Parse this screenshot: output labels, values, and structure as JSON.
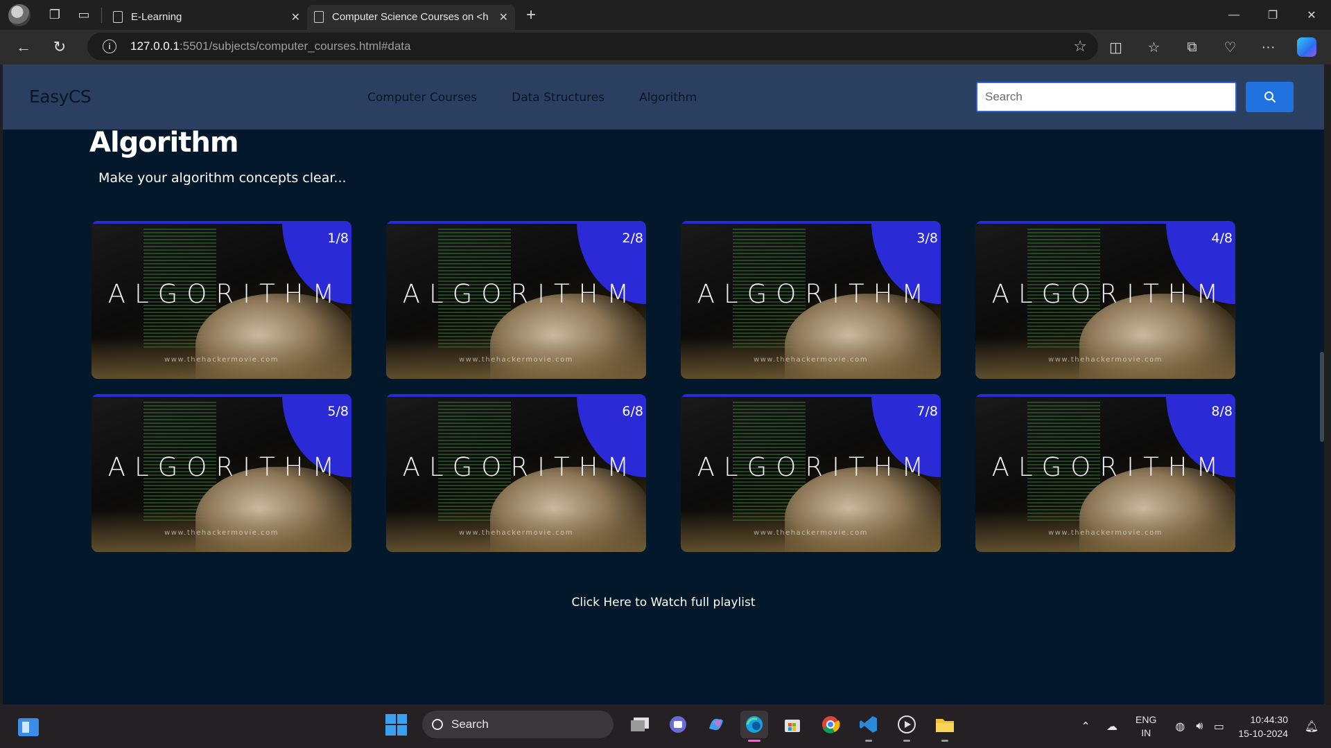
{
  "browser": {
    "tabs": [
      {
        "title": "E-Learning"
      },
      {
        "title": "Computer Science Courses on <h"
      }
    ],
    "url_host": "127.0.0.1",
    "url_rest": ":5501/subjects/computer_courses.html#data"
  },
  "site": {
    "brand": "EasyCS",
    "nav": [
      "Computer Courses",
      "Data Structures",
      "Algorithm"
    ],
    "search": {
      "placeholder": "Search",
      "value": ""
    }
  },
  "section": {
    "title": "Algorithm",
    "subtitle": "Make your algorithm concepts clear...",
    "cards": [
      {
        "count": "1/8",
        "thumb_text": "ALGORITHM",
        "watermark": "www.thehackermovie.com"
      },
      {
        "count": "2/8",
        "thumb_text": "ALGORITHM",
        "watermark": "www.thehackermovie.com"
      },
      {
        "count": "3/8",
        "thumb_text": "ALGORITHM",
        "watermark": "www.thehackermovie.com"
      },
      {
        "count": "4/8",
        "thumb_text": "ALGORITHM",
        "watermark": "www.thehackermovie.com"
      },
      {
        "count": "5/8",
        "thumb_text": "ALGORITHM",
        "watermark": "www.thehackermovie.com"
      },
      {
        "count": "6/8",
        "thumb_text": "ALGORITHM",
        "watermark": "www.thehackermovie.com"
      },
      {
        "count": "7/8",
        "thumb_text": "ALGORITHM",
        "watermark": "www.thehackermovie.com"
      },
      {
        "count": "8/8",
        "thumb_text": "ALGORITHM",
        "watermark": "www.thehackermovie.com"
      }
    ],
    "playlist_link": "Click Here to Watch full playlist"
  },
  "taskbar": {
    "search_label": "Search",
    "lang_line1": "ENG",
    "lang_line2": "IN",
    "time": "10:44:30",
    "date": "15-10-2024"
  },
  "colors": {
    "page_bg": "#04182b",
    "header_bg": "#2b4060",
    "accent_blue": "#1f72e0",
    "card_wedge": "#2a2bd6"
  }
}
